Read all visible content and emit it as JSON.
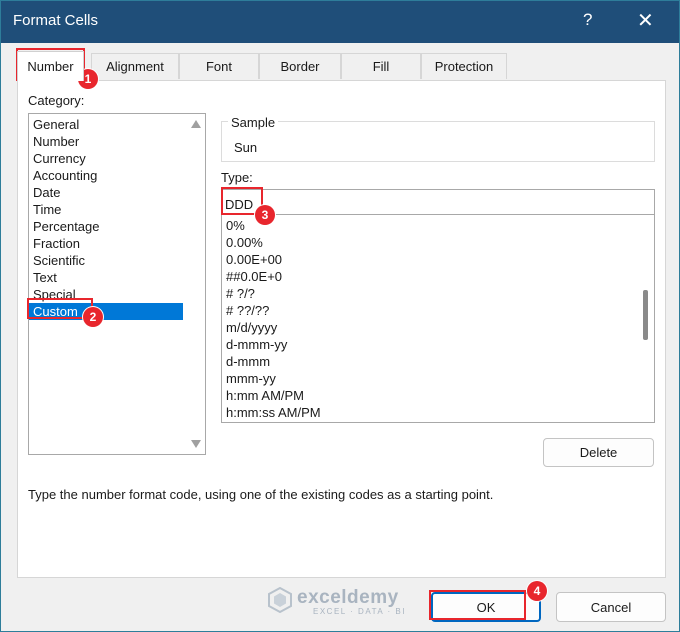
{
  "window": {
    "title": "Format Cells",
    "help_glyph": "?",
    "close_glyph": "✕",
    "titlebar_color": "#1f4e79"
  },
  "tabs": [
    {
      "label": "Number",
      "active": true
    },
    {
      "label": "Alignment",
      "active": false
    },
    {
      "label": "Font",
      "active": false
    },
    {
      "label": "Border",
      "active": false
    },
    {
      "label": "Fill",
      "active": false
    },
    {
      "label": "Protection",
      "active": false
    }
  ],
  "category": {
    "label": "Category:",
    "items": [
      "General",
      "Number",
      "Currency",
      "Accounting",
      "Date",
      "Time",
      "Percentage",
      "Fraction",
      "Scientific",
      "Text",
      "Special",
      "Custom"
    ],
    "selected": "Custom"
  },
  "sample": {
    "label": "Sample",
    "value": "Sun"
  },
  "type": {
    "label": "Type:",
    "value": "DDD",
    "formats": [
      "0%",
      "0.00%",
      "0.00E+00",
      "##0.0E+0",
      "# ?/?",
      "# ??/??",
      "m/d/yyyy",
      "d-mmm-yy",
      "d-mmm",
      "mmm-yy",
      "h:mm AM/PM",
      "h:mm:ss AM/PM"
    ]
  },
  "buttons": {
    "delete": "Delete",
    "ok": "OK",
    "cancel": "Cancel"
  },
  "hint": "Type the number format code, using one of the existing codes as a starting point.",
  "callouts": [
    "1",
    "2",
    "3",
    "4"
  ],
  "watermark": {
    "name": "exceldemy",
    "tagline": "EXCEL · DATA · BI"
  },
  "colors": {
    "accent": "#0078d7",
    "callout": "#e8262d"
  }
}
